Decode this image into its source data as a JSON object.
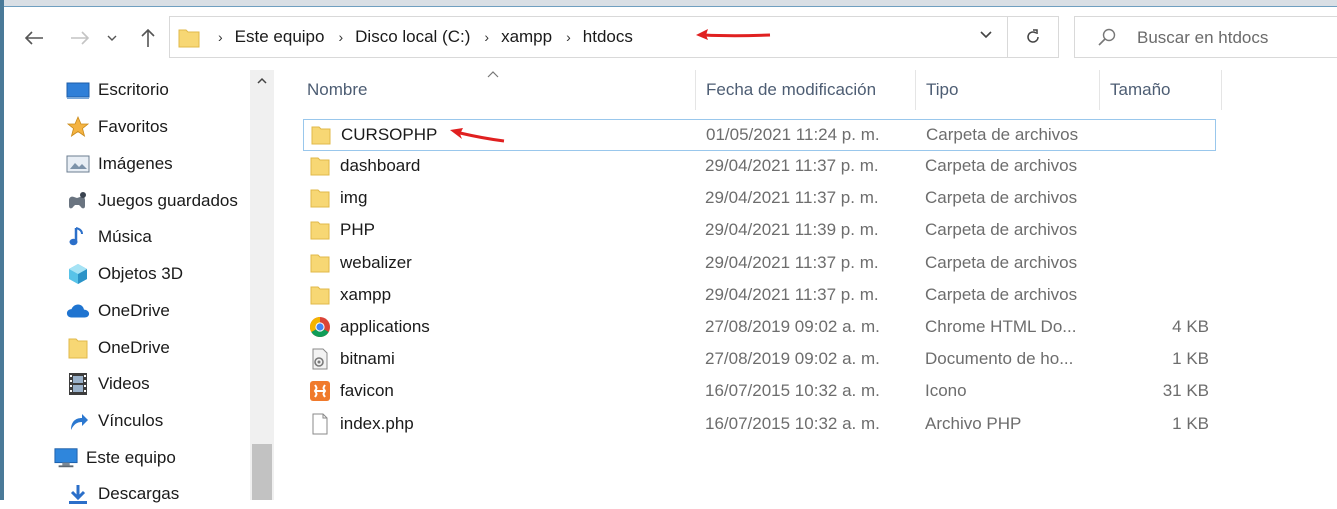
{
  "nav": {
    "back_icon": "arrow-left-icon",
    "forward_icon": "arrow-right-icon",
    "recent_icon": "chevron-down-icon",
    "up_icon": "arrow-up-icon"
  },
  "address": {
    "crumbs": [
      "Este equipo",
      "Disco local (C:)",
      "xampp",
      "htdocs"
    ]
  },
  "search": {
    "placeholder": "Buscar en htdocs"
  },
  "sidebar": {
    "items": [
      {
        "label": "Escritorio",
        "icon": "desktop-icon"
      },
      {
        "label": "Favoritos",
        "icon": "star-icon"
      },
      {
        "label": "Imágenes",
        "icon": "pictures-icon"
      },
      {
        "label": "Juegos guardados",
        "icon": "saved-games-icon"
      },
      {
        "label": "Música",
        "icon": "music-icon"
      },
      {
        "label": "Objetos 3D",
        "icon": "cube-3d-icon"
      },
      {
        "label": "OneDrive",
        "icon": "cloud-icon"
      },
      {
        "label": "OneDrive",
        "icon": "folder-icon"
      },
      {
        "label": "Videos",
        "icon": "film-icon"
      },
      {
        "label": "Vínculos",
        "icon": "link-icon"
      },
      {
        "label": "Este equipo",
        "icon": "computer-icon"
      },
      {
        "label": "Descargas",
        "icon": "download-icon"
      }
    ]
  },
  "columns": {
    "name": "Nombre",
    "date": "Fecha de modificación",
    "type": "Tipo",
    "size": "Tamaño"
  },
  "files": [
    {
      "name": "CURSOPHP",
      "date": "01/05/2021 11:24 p. m.",
      "type": "Carpeta de archivos",
      "size": "",
      "icon": "folder-icon"
    },
    {
      "name": "dashboard",
      "date": "29/04/2021 11:37 p. m.",
      "type": "Carpeta de archivos",
      "size": "",
      "icon": "folder-icon"
    },
    {
      "name": "img",
      "date": "29/04/2021 11:37 p. m.",
      "type": "Carpeta de archivos",
      "size": "",
      "icon": "folder-icon"
    },
    {
      "name": "PHP",
      "date": "29/04/2021 11:39 p. m.",
      "type": "Carpeta de archivos",
      "size": "",
      "icon": "folder-icon"
    },
    {
      "name": "webalizer",
      "date": "29/04/2021 11:37 p. m.",
      "type": "Carpeta de archivos",
      "size": "",
      "icon": "folder-icon"
    },
    {
      "name": "xampp",
      "date": "29/04/2021 11:37 p. m.",
      "type": "Carpeta de archivos",
      "size": "",
      "icon": "folder-icon"
    },
    {
      "name": "applications",
      "date": "27/08/2019 09:02 a. m.",
      "type": "Chrome HTML Do...",
      "size": "4 KB",
      "icon": "chrome-icon"
    },
    {
      "name": "bitnami",
      "date": "27/08/2019 09:02 a. m.",
      "type": "Documento de ho...",
      "size": "1 KB",
      "icon": "stylesheet-icon"
    },
    {
      "name": "favicon",
      "date": "16/07/2015 10:32 a. m.",
      "type": "Icono",
      "size": "31 KB",
      "icon": "xampp-icon"
    },
    {
      "name": "index.php",
      "date": "16/07/2015 10:32 a. m.",
      "type": "Archivo PHP",
      "size": "1 KB",
      "icon": "file-icon"
    }
  ],
  "colors": {
    "selection_border": "#99c7ec",
    "annotation_arrow": "#e02020",
    "folder": "#f7d774"
  }
}
